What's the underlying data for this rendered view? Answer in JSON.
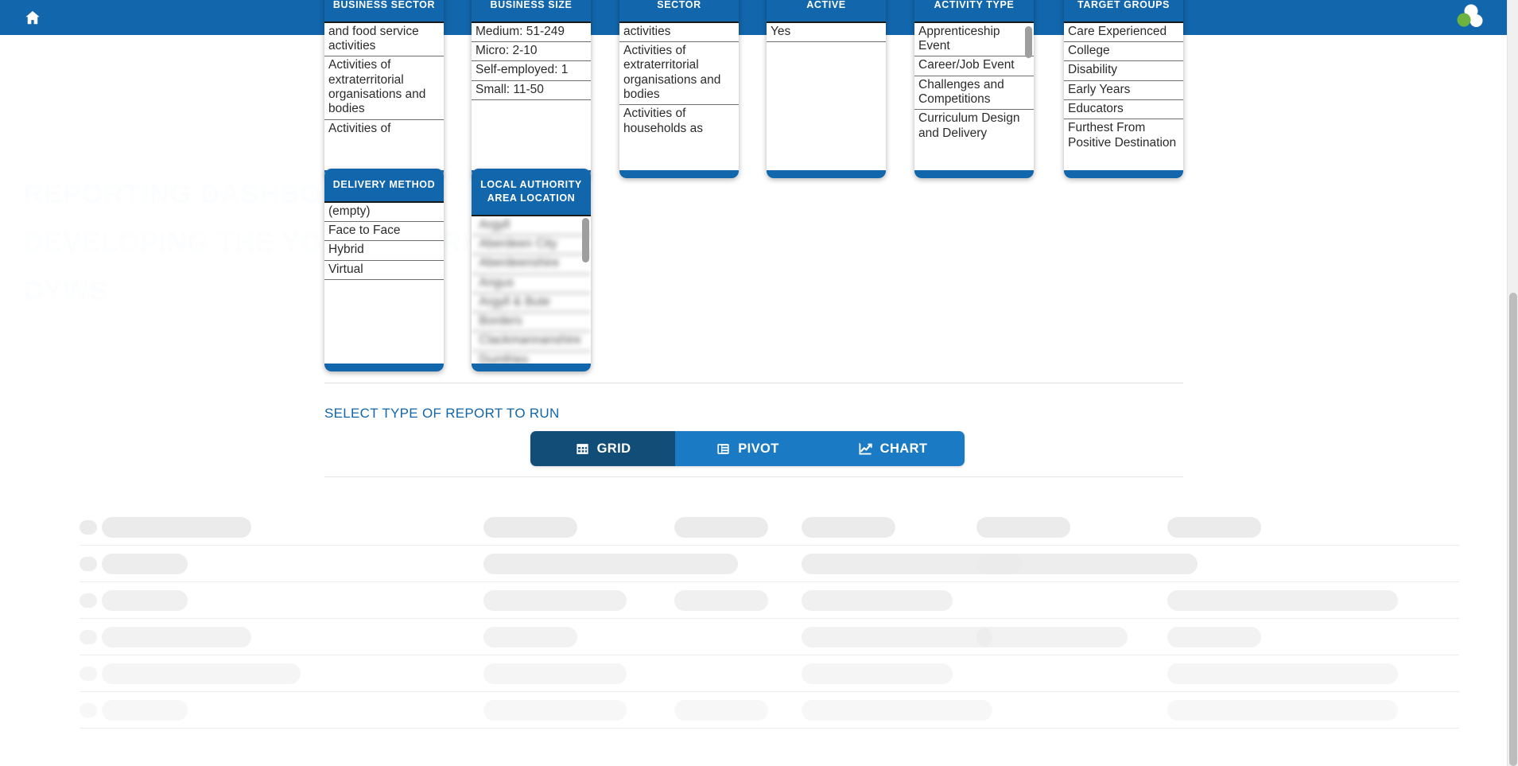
{
  "appbar": {
    "home_icon": "home-icon",
    "brand_logo": "three-circles-logo",
    "background": "#1266ab"
  },
  "watermark": {
    "line1": "REPORTING DASHBOARD",
    "line2": "DEVELOPING THE YOUNG WORKFORCE",
    "line3": "DYWS"
  },
  "filters": {
    "panels": [
      {
        "name": "business-sector",
        "title": "BUSINESS SECTOR",
        "clipped_top": true,
        "scrollbar": false,
        "items": [
          "and food service activities",
          "Activities of extraterritorial organisations and bodies",
          "Activities of"
        ]
      },
      {
        "name": "business-size",
        "title": "BUSINESS SIZE",
        "clipped_top": true,
        "scrollbar": false,
        "items": [
          "Medium: 51-249",
          "Micro: 2-10",
          "Self-employed: 1",
          "Small: 11-50"
        ]
      },
      {
        "name": "sector-secondary",
        "title": "SECTOR",
        "clipped_top": true,
        "scrollbar": false,
        "items": [
          "activities",
          "Activities of extraterritorial organisations and bodies",
          "Activities of households as"
        ]
      },
      {
        "name": "yes-no-filter",
        "title": "ACTIVE",
        "clipped_top": true,
        "scrollbar": false,
        "items": [
          "Yes"
        ]
      },
      {
        "name": "activity-type",
        "title": "ACTIVITY TYPE",
        "clipped_top": true,
        "scrollbar": true,
        "items": [
          "Apprenticeship Event",
          "Career/Job Event",
          "Challenges and Competitions",
          "Curriculum Design and Delivery"
        ]
      },
      {
        "name": "target-groups",
        "title": "TARGET GROUPS",
        "clipped_top": true,
        "scrollbar": false,
        "items": [
          "Care Experienced",
          "College",
          "Disability",
          "Early Years",
          "Educators",
          "Furthest From Positive Destination"
        ]
      }
    ],
    "delivery_method": {
      "title": "DELIVERY METHOD",
      "items": [
        "(empty)",
        "Face to Face",
        "Hybrid",
        "Virtual"
      ]
    },
    "local_authority": {
      "title": "LOCAL AUTHORITY AREA LOCATION",
      "loading": true,
      "items": [
        "",
        "",
        "",
        "",
        "",
        "",
        "",
        "",
        ""
      ]
    }
  },
  "report_section": {
    "label": "SELECT TYPE OF REPORT TO RUN",
    "buttons": [
      {
        "name": "grid",
        "label": "GRID",
        "icon": "grid-icon",
        "selected": true
      },
      {
        "name": "pivot",
        "label": "PIVOT",
        "icon": "pivot-icon",
        "selected": false
      },
      {
        "name": "chart",
        "label": "CHART",
        "icon": "line-chart-icon",
        "selected": false
      }
    ],
    "active_color": "#114d77",
    "inactive_color": "#1a7ac4"
  },
  "results": {
    "state": "loading",
    "skeleton_rows": [
      [
        [
          0,
          22,
          18
        ],
        [
          28,
          188,
          26
        ],
        [
          508,
          118,
          26
        ],
        [
          748,
          118,
          26
        ],
        [
          908,
          118,
          26
        ],
        [
          1128,
          118,
          26
        ],
        [
          1368,
          118,
          26
        ]
      ],
      [
        [
          0,
          22,
          18
        ],
        [
          28,
          108,
          26
        ],
        [
          508,
          320,
          26
        ],
        [
          748,
          0,
          0
        ],
        [
          908,
          278,
          26
        ],
        [
          1128,
          278,
          26
        ],
        [
          1368,
          0,
          0
        ]
      ],
      [
        [
          0,
          22,
          18
        ],
        [
          28,
          108,
          26
        ],
        [
          508,
          180,
          26
        ],
        [
          748,
          118,
          26
        ],
        [
          908,
          190,
          26
        ],
        [
          1128,
          0,
          0
        ],
        [
          1368,
          290,
          26
        ]
      ],
      [
        [
          0,
          22,
          18
        ],
        [
          28,
          188,
          26
        ],
        [
          508,
          118,
          26
        ],
        [
          748,
          0,
          0
        ],
        [
          908,
          240,
          26
        ],
        [
          1128,
          190,
          26
        ],
        [
          1368,
          118,
          26
        ]
      ],
      [
        [
          0,
          22,
          18
        ],
        [
          28,
          250,
          26
        ],
        [
          508,
          180,
          26
        ],
        [
          748,
          0,
          0
        ],
        [
          908,
          190,
          26
        ],
        [
          1128,
          0,
          0
        ],
        [
          1368,
          290,
          26
        ]
      ],
      [
        [
          0,
          22,
          18
        ],
        [
          28,
          108,
          26
        ],
        [
          508,
          180,
          26
        ],
        [
          748,
          118,
          26
        ],
        [
          908,
          240,
          26
        ],
        [
          1128,
          0,
          0
        ],
        [
          1368,
          290,
          26
        ]
      ]
    ]
  },
  "scrollbar": {
    "name": "page-scrollbar"
  }
}
